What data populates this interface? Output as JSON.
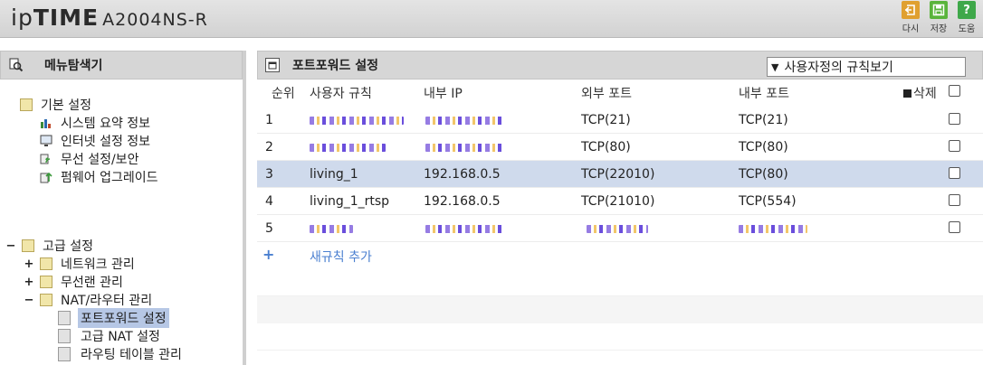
{
  "header": {
    "logo_prefix": "ip",
    "logo_brand": "TIME",
    "model": "A2004NS-R",
    "buttons": [
      {
        "label": "다시",
        "icon": "back-icon",
        "color": "#e0a030"
      },
      {
        "label": "저장",
        "icon": "save-icon",
        "color": "#5ab43c"
      },
      {
        "label": "도움",
        "icon": "help-icon",
        "color": "#3fa84a"
      }
    ]
  },
  "sidebar": {
    "title": "메뉴탐색기",
    "basic": {
      "label": "기본 설정",
      "items": [
        "시스템 요약 정보",
        "인터넷 설정 정보",
        "무선 설정/보안",
        "펌웨어 업그레이드"
      ]
    },
    "advanced": {
      "label": "고급 설정",
      "items": [
        {
          "label": "네트워크 관리",
          "toggle": "+"
        },
        {
          "label": "무선랜 관리",
          "toggle": "+"
        },
        {
          "label": "NAT/라우터 관리",
          "toggle": "−"
        }
      ],
      "nat_children": [
        "포트포워드 설정",
        "고급 NAT 설정",
        "라우팅 테이블 관리"
      ]
    }
  },
  "main": {
    "title": "포트포워드 설정",
    "view_select": "사용자정의 규칙보기",
    "columns": {
      "order": "순위",
      "rule": "사용자 규칙",
      "internal_ip": "내부 IP",
      "external_port": "외부 포트",
      "internal_port": "내부 포트",
      "delete": "삭제"
    },
    "rows": [
      {
        "order": "1",
        "rule": "",
        "ip": "",
        "ext": "TCP(21)",
        "int": "TCP(21)",
        "selected": false
      },
      {
        "order": "2",
        "rule": "",
        "ip": "",
        "ext": "TCP(80)",
        "int": "TCP(80)",
        "selected": false
      },
      {
        "order": "3",
        "rule": "living_1",
        "ip": "192.168.0.5",
        "ext": "TCP(22010)",
        "int": "TCP(80)",
        "selected": true
      },
      {
        "order": "4",
        "rule": "living_1_rtsp",
        "ip": "192.168.0.5",
        "ext": "TCP(21010)",
        "int": "TCP(554)",
        "selected": false
      },
      {
        "order": "5",
        "rule": "",
        "ip": "",
        "ext": "",
        "int": "",
        "selected": false
      }
    ],
    "add_rule": "새규칙 추가",
    "add_icon": "plus-icon"
  }
}
